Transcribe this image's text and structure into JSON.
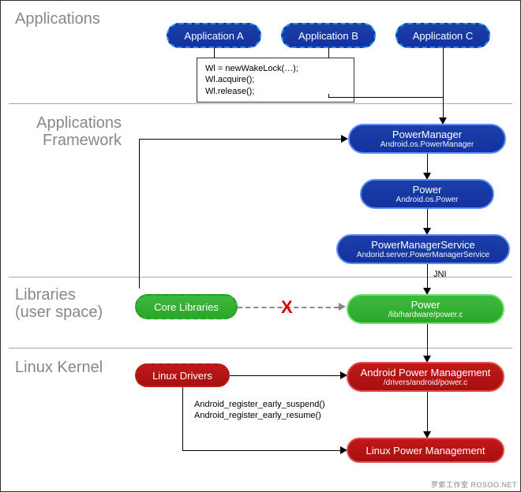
{
  "sections": {
    "applications": "Applications",
    "framework_l1": "Applications",
    "framework_l2": "Framework",
    "libraries_l1": "Libraries",
    "libraries_l2": "(user space)",
    "kernel": "Linux Kernel"
  },
  "apps": {
    "a": "Application A",
    "b": "Application B",
    "c": "Application C"
  },
  "code": {
    "l1": "Wl = newWakeLock(…);",
    "l2": "Wl.acquire();",
    "l3": "Wl.release();"
  },
  "framework": {
    "pm_t1": "PowerManager",
    "pm_t2": "Android.os.PowerManager",
    "power_t1": "Power",
    "power_t2": "Android.os.Power",
    "pms_t1": "PowerManagerService",
    "pms_t2": "Andorid.server.PowerManagerService",
    "jni": "JNI"
  },
  "libs": {
    "core": "Core Libraries",
    "power_t1": "Power",
    "power_t2": "/lib/hardware/power.c",
    "x": "X"
  },
  "kernel": {
    "drivers": "Linux Drivers",
    "apm_t1": "Android Power Management",
    "apm_t2": "/drivers/android/power.c",
    "lpm": "Linux Power Management",
    "reg1": "Android_register_early_suspend()",
    "reg2": "Android_register_early_resume()"
  },
  "watermark": "罗索工作室  ROSOO.NET"
}
